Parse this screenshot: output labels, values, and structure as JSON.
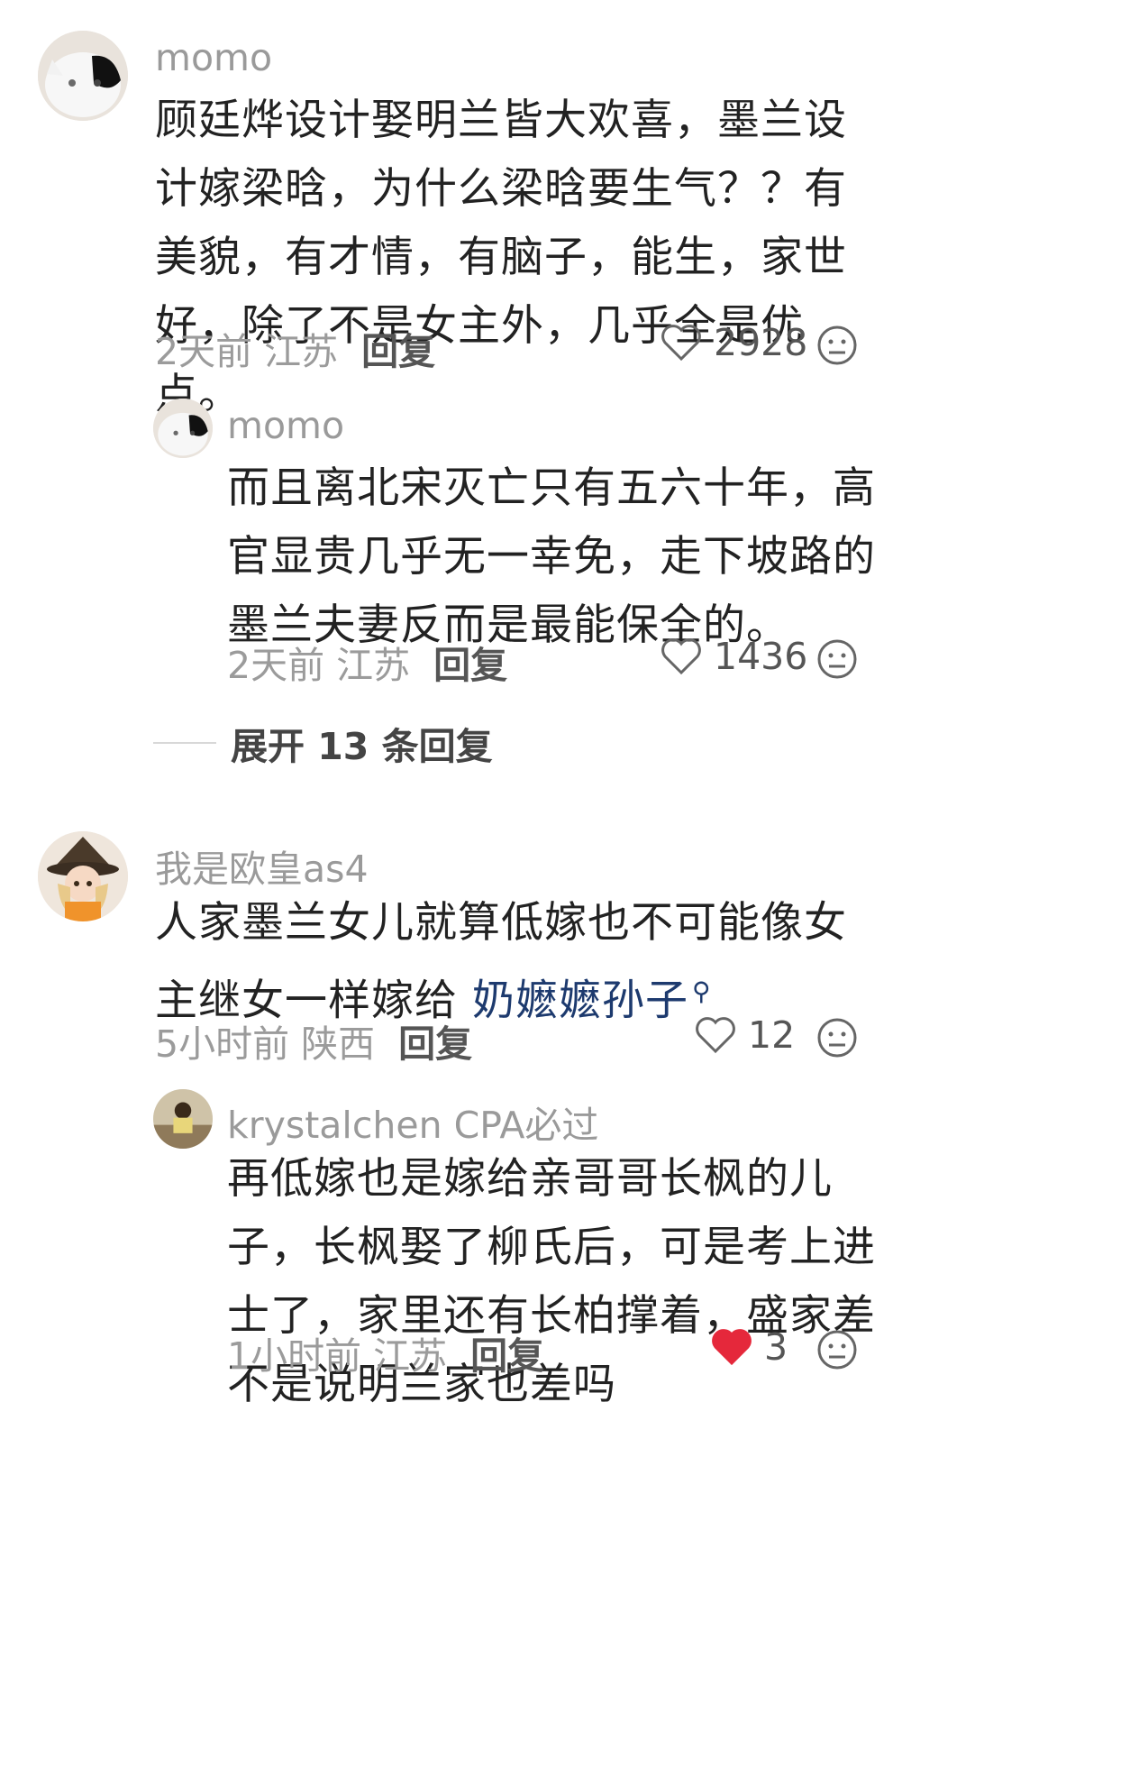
{
  "comments": [
    {
      "user": "momo",
      "text": "顾廷烨设计娶明兰皆大欢喜，墨兰设计嫁梁晗，为什么梁晗要生气？？有美貌，有才情，有脑子，能生，家世好，除了不是女主外，几乎全是优点。",
      "time_loc": "2天前 江苏",
      "reply": "回复",
      "likes": "2928"
    },
    {
      "user": "momo",
      "text": "而且离北宋灭亡只有五六十年，高官显贵几乎无一幸免，走下坡路的墨兰夫妻反而是最能保全的。",
      "time_loc": "2天前 江苏",
      "reply": "回复",
      "likes": "1436"
    },
    {
      "expand": "展开 13 条回复"
    },
    {
      "user": "我是欧皇as4",
      "text_prefix": "人家墨兰女儿就算低嫁也不可能像女主继女一样嫁给 ",
      "link": "奶嬷嬷孙子",
      "time_loc": "5小时前 陕西",
      "reply": "回复",
      "likes": "12"
    },
    {
      "user": "krystalchen CPA必过",
      "text": "再低嫁也是嫁给亲哥哥长枫的儿子，长枫娶了柳氏后，可是考上进士了，家里还有长柏撑着，盛家差不是说明兰家也差吗",
      "time_loc": "1小时前 江苏",
      "reply": "回复",
      "likes": "3",
      "liked": true
    }
  ],
  "colors": {
    "heart_liked": "#e5283b",
    "link": "#1d3a6e"
  }
}
